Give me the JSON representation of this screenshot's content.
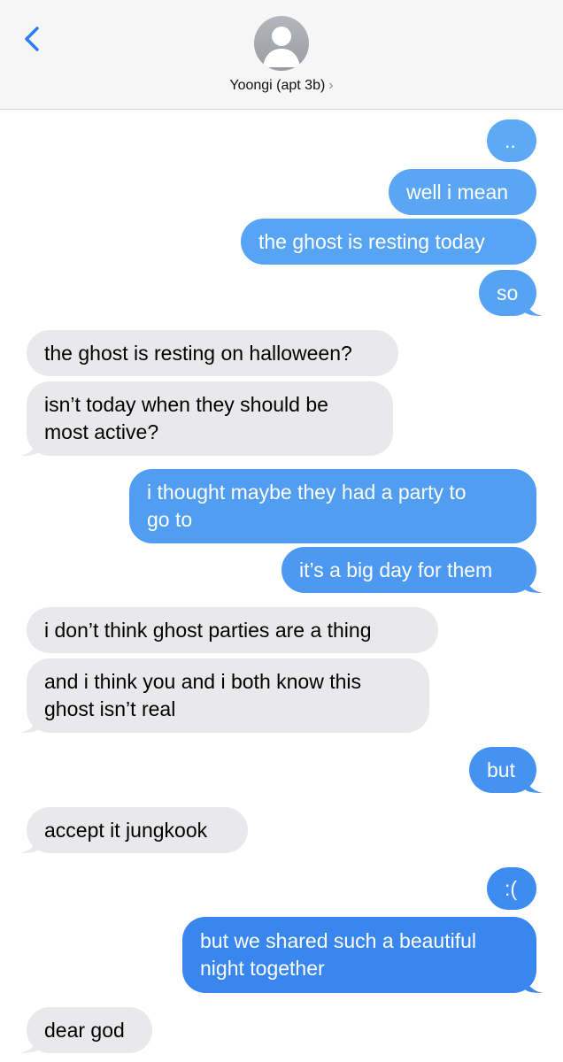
{
  "header": {
    "contact_name": "Yoongi (apt 3b)",
    "chevron": "›"
  },
  "colors": {
    "sent_light": "#5aa6f4",
    "sent_dark": "#3a84f0",
    "received": "#e9e9eb",
    "accent": "#2f7cf6"
  },
  "messages": [
    {
      "from": "me",
      "text": ".."
    },
    {
      "from": "me",
      "text": "well i mean"
    },
    {
      "from": "me",
      "text": "the ghost is resting today"
    },
    {
      "from": "me",
      "text": "so"
    },
    {
      "from": "them",
      "text": "the ghost is resting on halloween?"
    },
    {
      "from": "them",
      "text": "isn’t today when they should be\nmost active?"
    },
    {
      "from": "me",
      "text": "i thought maybe they had a party to\ngo to"
    },
    {
      "from": "me",
      "text": "it’s a big day for them"
    },
    {
      "from": "them",
      "text": "i don’t think ghost parties are a thing"
    },
    {
      "from": "them",
      "text": "and i think you and i both know this\nghost isn’t real"
    },
    {
      "from": "me",
      "text": "but"
    },
    {
      "from": "them",
      "text": "accept it jungkook"
    },
    {
      "from": "me",
      "text": ":("
    },
    {
      "from": "me",
      "text": "but we shared such a beautiful\nnight together"
    },
    {
      "from": "them",
      "text": "dear god"
    }
  ]
}
